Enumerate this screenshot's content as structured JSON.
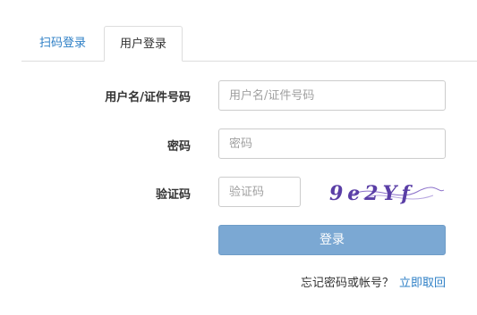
{
  "tabs": {
    "scan_login": "扫码登录",
    "user_login": "用户登录"
  },
  "form": {
    "username_label": "用户名/证件号码",
    "username_placeholder": "用户名/证件号码",
    "password_label": "密码",
    "password_placeholder": "密码",
    "captcha_label": "验证码",
    "captcha_placeholder": "验证码",
    "captcha_text": "9e2Yf"
  },
  "login_button": "登录",
  "forgot": {
    "question": "忘记密码或帐号？",
    "link": "立即取回"
  },
  "colors": {
    "link": "#2d7fc6",
    "button": "#7ba8d3",
    "captcha": "#5a3ea6"
  }
}
